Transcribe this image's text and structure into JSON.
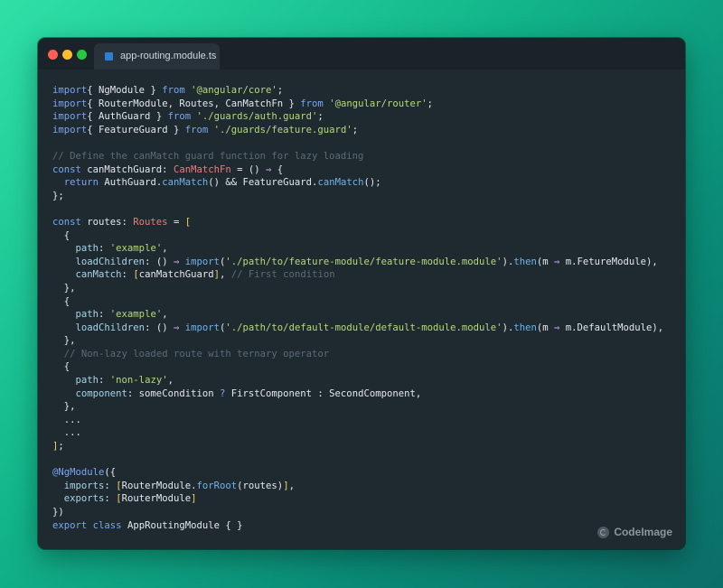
{
  "tab": {
    "filename": "app-routing.module.ts"
  },
  "code": {
    "lines": [
      [
        [
          "kw",
          "import"
        ],
        [
          "",
          "{ NgModule } "
        ],
        [
          "kw",
          "from"
        ],
        [
          "",
          " "
        ],
        [
          "str",
          "'@angular/core'"
        ],
        [
          "",
          ";"
        ]
      ],
      [
        [
          "kw",
          "import"
        ],
        [
          "",
          "{ RouterModule, Routes, CanMatchFn } "
        ],
        [
          "kw",
          "from"
        ],
        [
          "",
          " "
        ],
        [
          "str",
          "'@angular/router'"
        ],
        [
          "",
          ";"
        ]
      ],
      [
        [
          "kw",
          "import"
        ],
        [
          "",
          "{ AuthGuard } "
        ],
        [
          "kw",
          "from"
        ],
        [
          "",
          " "
        ],
        [
          "str",
          "'./guards/auth.guard'"
        ],
        [
          "",
          ";"
        ]
      ],
      [
        [
          "kw",
          "import"
        ],
        [
          "",
          "{ FeatureGuard } "
        ],
        [
          "kw",
          "from"
        ],
        [
          "",
          " "
        ],
        [
          "str",
          "'./guards/feature.guard'"
        ],
        [
          "",
          ";"
        ]
      ],
      [],
      [
        [
          "cm",
          "// Define the canMatch guard function for lazy loading"
        ]
      ],
      [
        [
          "kw",
          "const"
        ],
        [
          "",
          " canMatchGuard: "
        ],
        [
          "ty",
          "CanMatchFn"
        ],
        [
          "",
          " = () "
        ],
        [
          "ar",
          "⇒"
        ],
        [
          "",
          " {"
        ]
      ],
      [
        [
          "",
          "  "
        ],
        [
          "kw",
          "return"
        ],
        [
          "",
          " AuthGuard."
        ],
        [
          "fn",
          "canMatch"
        ],
        [
          "",
          "() && FeatureGuard."
        ],
        [
          "fn",
          "canMatch"
        ],
        [
          "",
          "();"
        ]
      ],
      [
        [
          "",
          "};"
        ]
      ],
      [],
      [
        [
          "kw",
          "const"
        ],
        [
          "",
          " routes: "
        ],
        [
          "ty",
          "Routes"
        ],
        [
          "",
          " = "
        ],
        [
          "br",
          "["
        ]
      ],
      [
        [
          "",
          "  {"
        ]
      ],
      [
        [
          "",
          "    "
        ],
        [
          "pr",
          "path"
        ],
        [
          "",
          ": "
        ],
        [
          "str",
          "'example'"
        ],
        [
          "",
          ","
        ]
      ],
      [
        [
          "",
          "    "
        ],
        [
          "pr",
          "loadChildren"
        ],
        [
          "",
          ": () "
        ],
        [
          "ar",
          "⇒"
        ],
        [
          "",
          " "
        ],
        [
          "fn",
          "import"
        ],
        [
          "",
          "("
        ],
        [
          "str",
          "'./path/to/feature-module/feature-module.module'"
        ],
        [
          "",
          ")."
        ],
        [
          "fn",
          "then"
        ],
        [
          "",
          "(m "
        ],
        [
          "ar",
          "⇒"
        ],
        [
          "",
          " m.FetureModule),"
        ]
      ],
      [
        [
          "",
          "    "
        ],
        [
          "pr",
          "canMatch"
        ],
        [
          "",
          ": "
        ],
        [
          "br",
          "["
        ],
        [
          "",
          "canMatchGuard"
        ],
        [
          "br",
          "]"
        ],
        [
          "",
          ", "
        ],
        [
          "cm",
          "// First condition"
        ]
      ],
      [
        [
          "",
          "  },"
        ]
      ],
      [
        [
          "",
          "  {"
        ]
      ],
      [
        [
          "",
          "    "
        ],
        [
          "pr",
          "path"
        ],
        [
          "",
          ": "
        ],
        [
          "str",
          "'example'"
        ],
        [
          "",
          ","
        ]
      ],
      [
        [
          "",
          "    "
        ],
        [
          "pr",
          "loadChildren"
        ],
        [
          "",
          ": () "
        ],
        [
          "ar",
          "⇒"
        ],
        [
          "",
          " "
        ],
        [
          "fn",
          "import"
        ],
        [
          "",
          "("
        ],
        [
          "str",
          "'./path/to/default-module/default-module.module'"
        ],
        [
          "",
          ")."
        ],
        [
          "fn",
          "then"
        ],
        [
          "",
          "(m "
        ],
        [
          "ar",
          "⇒"
        ],
        [
          "",
          " m.DefaultModule),"
        ]
      ],
      [
        [
          "",
          "  },"
        ]
      ],
      [
        [
          "",
          "  "
        ],
        [
          "cm",
          "// Non-lazy loaded route with ternary operator"
        ]
      ],
      [
        [
          "",
          "  {"
        ]
      ],
      [
        [
          "",
          "    "
        ],
        [
          "pr",
          "path"
        ],
        [
          "",
          ": "
        ],
        [
          "str",
          "'non-lazy'"
        ],
        [
          "",
          ","
        ]
      ],
      [
        [
          "",
          "    "
        ],
        [
          "pr",
          "component"
        ],
        [
          "",
          ": someCondition "
        ],
        [
          "kw",
          "?"
        ],
        [
          "",
          " FirstComponent : SecondComponent,"
        ]
      ],
      [
        [
          "",
          "  },"
        ]
      ],
      [
        [
          "",
          "  ..."
        ]
      ],
      [
        [
          "",
          "  ..."
        ]
      ],
      [
        [
          "br",
          "]"
        ],
        [
          "",
          ";"
        ]
      ],
      [],
      [
        [
          "dc",
          "@NgModule"
        ],
        [
          "",
          "({"
        ]
      ],
      [
        [
          "",
          "  "
        ],
        [
          "pr",
          "imports"
        ],
        [
          "",
          ": "
        ],
        [
          "br",
          "["
        ],
        [
          "",
          "RouterModule."
        ],
        [
          "fn",
          "forRoot"
        ],
        [
          "",
          "(routes)"
        ],
        [
          "br",
          "]"
        ],
        [
          "",
          ","
        ]
      ],
      [
        [
          "",
          "  "
        ],
        [
          "pr",
          "exports"
        ],
        [
          "",
          ": "
        ],
        [
          "br",
          "["
        ],
        [
          "",
          "RouterModule"
        ],
        [
          "br",
          "]"
        ]
      ],
      [
        [
          "",
          "})"
        ]
      ],
      [
        [
          "kw",
          "export"
        ],
        [
          "",
          " "
        ],
        [
          "kw",
          "class"
        ],
        [
          "",
          " AppRoutingModule { }"
        ]
      ]
    ]
  },
  "watermark": {
    "label": "CodeImage"
  }
}
